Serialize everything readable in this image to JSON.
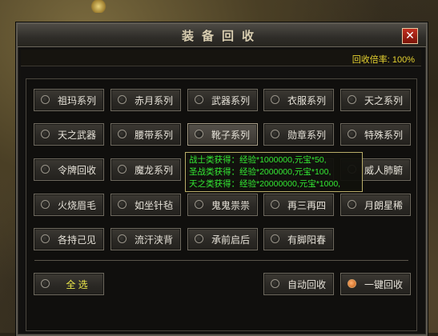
{
  "window": {
    "title": "装备回收",
    "recycle_rate": "回收倍率: 100%"
  },
  "categories": [
    [
      "祖玛系列",
      "赤月系列",
      "武器系列",
      "衣服系列",
      "天之系列"
    ],
    [
      "天之武器",
      "腰带系列",
      "靴子系列",
      "勋章系列",
      "特殊系列"
    ],
    [
      "令牌回收",
      "魔龙系列",
      "",
      "",
      "威人肺腑"
    ],
    [
      "火烧眉毛",
      "如坐针毡",
      "鬼鬼祟祟",
      "再三再四",
      "月朗星稀"
    ],
    [
      "各持己见",
      "流汗浃背",
      "承前启后",
      "有脚阳春"
    ]
  ],
  "bottom": {
    "select_all": "全 选",
    "auto_recycle": "自动回收",
    "one_key_recycle": "一键回收"
  },
  "tooltip": {
    "line1": "战士类获得：经验*1000000,元宝*50,",
    "line2": "圣战类获得：经验*2000000,元宝*100,",
    "line3": "天之类获得：经验*20000000,元宝*1000,"
  },
  "colors": {
    "tooltip_text": "#33e833",
    "rate_text": "#e6d230",
    "select_all_text": "#ece84a"
  }
}
